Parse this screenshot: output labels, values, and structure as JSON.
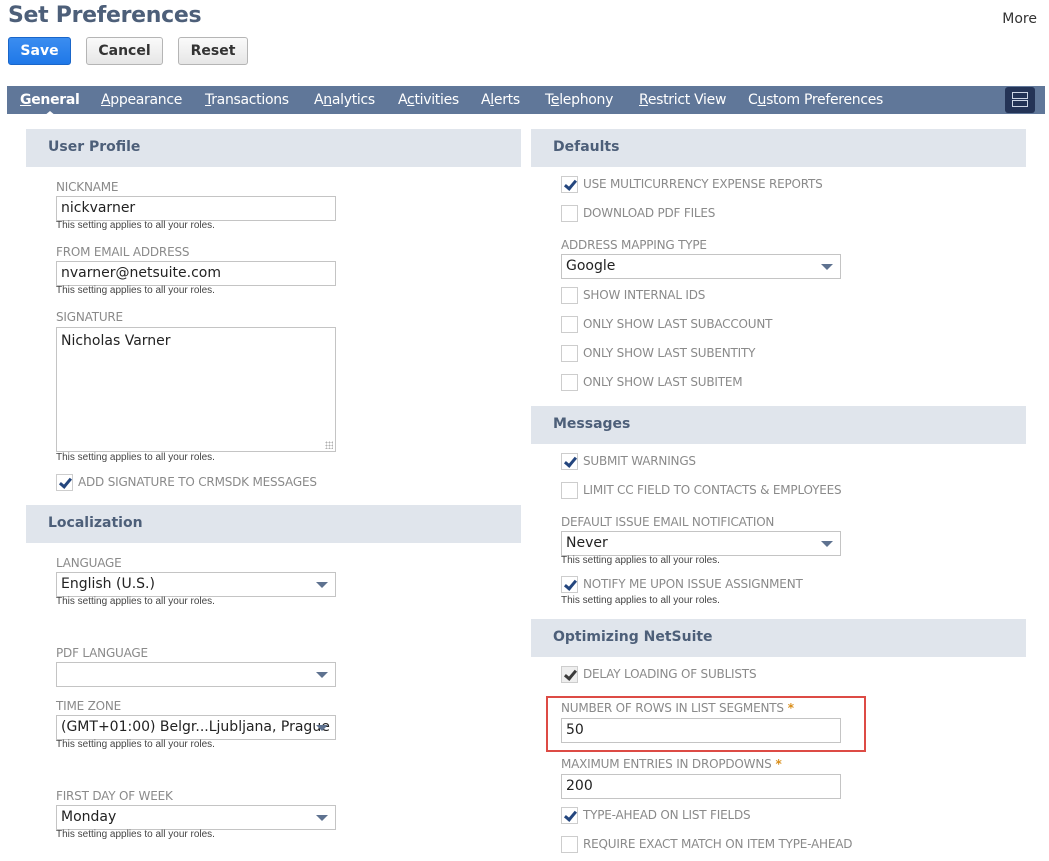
{
  "header": {
    "title": "Set Preferences",
    "more_label": "More",
    "buttons": {
      "save": "Save",
      "cancel": "Cancel",
      "reset": "Reset"
    },
    "colors": {
      "primary_button": "#1f78e8",
      "tabbar": "#607799",
      "section_header_bg": "#e0e5ec",
      "highlight": "#dd4b45"
    }
  },
  "tabs": [
    {
      "label": "General",
      "access_key": "G",
      "rest": "eneral",
      "prefix": "",
      "active": true
    },
    {
      "label": "Appearance",
      "prefix": "",
      "access_key": "A",
      "rest": "ppearance",
      "active": false
    },
    {
      "label": "Transactions",
      "prefix": "",
      "access_key": "T",
      "rest": "ransactions",
      "active": false
    },
    {
      "label": "Analytics",
      "prefix": "A",
      "access_key": "n",
      "rest": "alytics",
      "active": false
    },
    {
      "label": "Activities",
      "prefix": "A",
      "access_key": "c",
      "rest": "tivities",
      "active": false
    },
    {
      "label": "Alerts",
      "prefix": "A",
      "access_key": "l",
      "rest": "erts",
      "active": false
    },
    {
      "label": "Telephony",
      "prefix": "T",
      "access_key": "e",
      "rest": "lephony",
      "active": false
    },
    {
      "label": "Restrict View",
      "prefix": "",
      "access_key": "R",
      "rest": "estrict View",
      "active": false
    },
    {
      "label": "Custom Preferences",
      "prefix": "C",
      "access_key": "u",
      "rest": "stom Preferences",
      "active": false
    }
  ],
  "help_text": "This setting applies to all your roles.",
  "user_profile": {
    "title": "User Profile",
    "nickname": {
      "label": "Nickname",
      "value": "nickvarner"
    },
    "from_email": {
      "label": "From Email Address",
      "value": "nvarner@netsuite.com"
    },
    "signature": {
      "label": "Signature",
      "value": "Nicholas Varner"
    },
    "add_signature": {
      "label": "Add Signature to CRMSDK Messages",
      "checked": true
    }
  },
  "localization": {
    "title": "Localization",
    "language": {
      "label": "Language",
      "value": "English (U.S.)"
    },
    "pdf_language": {
      "label": "PDF Language",
      "value": ""
    },
    "time_zone": {
      "label": "Time Zone",
      "value": "(GMT+01:00) Belgr...Ljubljana, Prague"
    },
    "first_day_of_week": {
      "label": "First Day of Week",
      "value": "Monday"
    }
  },
  "defaults": {
    "title": "Defaults",
    "use_multicurrency": {
      "label": "Use Multicurrency Expense Reports",
      "checked": true
    },
    "download_pdf": {
      "label": "Download PDF Files",
      "checked": false
    },
    "address_mapping": {
      "label": "Address Mapping Type",
      "value": "Google"
    },
    "show_internal_ids": {
      "label": "Show Internal IDs",
      "checked": false
    },
    "only_last_subaccount": {
      "label": "Only Show Last Subaccount",
      "checked": false
    },
    "only_last_subentity": {
      "label": "Only Show Last Subentity",
      "checked": false
    },
    "only_last_subitem": {
      "label": "Only Show Last Subitem",
      "checked": false
    }
  },
  "messages": {
    "title": "Messages",
    "submit_warnings": {
      "label": "Submit Warnings",
      "checked": true
    },
    "limit_cc": {
      "label": "Limit CC Field to Contacts & Employees",
      "checked": false
    },
    "default_issue_email": {
      "label": "Default Issue Email Notification",
      "value": "Never"
    },
    "notify_issue_assignment": {
      "label": "Notify Me Upon Issue Assignment",
      "checked": true
    }
  },
  "optimizing": {
    "title": "Optimizing NetSuite",
    "delay_sublists": {
      "label": "Delay Loading of Sublists",
      "checked": true,
      "disabled": true
    },
    "rows_in_list_segments": {
      "label": "Number of Rows in List Segments",
      "required_mark": "*",
      "value": "50",
      "highlighted": true
    },
    "max_dropdown_entries": {
      "label": "Maximum Entries in Dropdowns",
      "required_mark": "*",
      "value": "200"
    },
    "type_ahead": {
      "label": "Type-Ahead on List Fields",
      "checked": true
    },
    "exact_match_type_ahead": {
      "label": "Require Exact Match on Item Type-Ahead",
      "checked": false
    }
  }
}
